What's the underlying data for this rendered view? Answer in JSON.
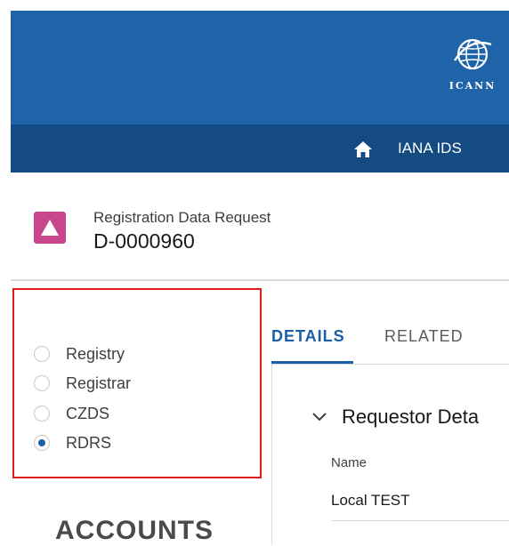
{
  "brand": {
    "logo_text": "ICANN",
    "banner_color": "#1f64a9",
    "nav_color": "#144b82"
  },
  "nav": {
    "home_icon": "home-icon",
    "items": [
      {
        "label": "IANA IDS"
      }
    ]
  },
  "record": {
    "icon": "triangle-icon",
    "icon_color": "#c8478a",
    "type_label": "Registration Data Request",
    "id": "D-0000960"
  },
  "request_options": {
    "items": [
      {
        "label": "Registry",
        "checked": false
      },
      {
        "label": "Registrar",
        "checked": false
      },
      {
        "label": "CZDS",
        "checked": false
      },
      {
        "label": "RDRS",
        "checked": true
      }
    ],
    "highlight_color": "#e01b1b"
  },
  "accounts": {
    "heading": "ACCOUNTS"
  },
  "tabs": [
    {
      "label": "DETAILS",
      "active": true
    },
    {
      "label": "RELATED",
      "active": false
    }
  ],
  "details": {
    "section_title": "Requestor Deta",
    "fields": [
      {
        "label": "Name",
        "value": "Local TEST"
      }
    ]
  }
}
